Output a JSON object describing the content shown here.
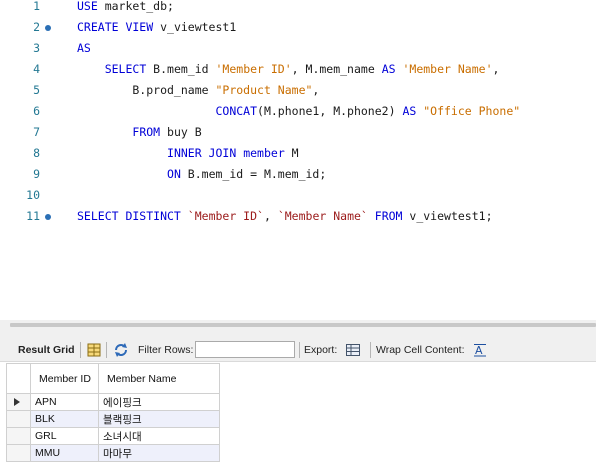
{
  "editor": {
    "lines": [
      {
        "n": "1",
        "fold": false,
        "tokens": [
          [
            "kw",
            "USE"
          ],
          [
            "tx",
            " market_db;"
          ]
        ]
      },
      {
        "n": "2",
        "fold": true,
        "tokens": [
          [
            "kw",
            "CREATE VIEW"
          ],
          [
            "tx",
            " v_viewtest1"
          ]
        ]
      },
      {
        "n": "3",
        "fold": false,
        "tokens": [
          [
            "kw",
            "AS"
          ]
        ]
      },
      {
        "n": "4",
        "fold": false,
        "tokens": [
          [
            "tx",
            "    "
          ],
          [
            "kw",
            "SELECT"
          ],
          [
            "tx",
            " B.mem_id "
          ],
          [
            "str",
            "'Member ID'"
          ],
          [
            "tx",
            ", M.mem_name "
          ],
          [
            "kw",
            "AS"
          ],
          [
            "tx",
            " "
          ],
          [
            "str",
            "'Member Name'"
          ],
          [
            "tx",
            ","
          ]
        ]
      },
      {
        "n": "5",
        "fold": false,
        "tokens": [
          [
            "tx",
            "        B.prod_name "
          ],
          [
            "str",
            "\"Product Name\""
          ],
          [
            "tx",
            ","
          ]
        ]
      },
      {
        "n": "6",
        "fold": false,
        "tokens": [
          [
            "tx",
            "                    "
          ],
          [
            "kw",
            "CONCAT"
          ],
          [
            "tx",
            "(M.phone1, M.phone2) "
          ],
          [
            "kw",
            "AS"
          ],
          [
            "tx",
            " "
          ],
          [
            "str",
            "\"Office Phone\""
          ]
        ]
      },
      {
        "n": "7",
        "fold": false,
        "tokens": [
          [
            "tx",
            "        "
          ],
          [
            "kw",
            "FROM"
          ],
          [
            "tx",
            " buy B"
          ]
        ]
      },
      {
        "n": "8",
        "fold": false,
        "tokens": [
          [
            "tx",
            "             "
          ],
          [
            "kw",
            "INNER JOIN"
          ],
          [
            "tx",
            " "
          ],
          [
            "kw",
            "member"
          ],
          [
            "tx",
            " M"
          ]
        ]
      },
      {
        "n": "9",
        "fold": false,
        "tokens": [
          [
            "tx",
            "             "
          ],
          [
            "kw",
            "ON"
          ],
          [
            "tx",
            " B.mem_id = M.mem_id;"
          ]
        ]
      },
      {
        "n": "10",
        "fold": false,
        "tokens": []
      },
      {
        "n": "11",
        "fold": true,
        "tokens": [
          [
            "kw",
            "SELECT DISTINCT"
          ],
          [
            "tx",
            " "
          ],
          [
            "id",
            "`Member ID`"
          ],
          [
            "tx",
            ", "
          ],
          [
            "id",
            "`Member Name`"
          ],
          [
            "tx",
            " "
          ],
          [
            "kw",
            "FROM"
          ],
          [
            "tx",
            " v_viewtest1;"
          ]
        ]
      }
    ]
  },
  "toolbar": {
    "result_grid": "Result Grid",
    "filter_rows": "Filter Rows:",
    "filter_value": "",
    "export": "Export:",
    "wrap_cell": "Wrap Cell Content:",
    "wrap_icon": "wrap-icon",
    "grid_icon": "grid-view-icon",
    "refresh_icon": "refresh-icon",
    "export_icon": "export-icon"
  },
  "grid": {
    "columns": [
      "Member ID",
      "Member Name"
    ],
    "rows": [
      [
        "APN",
        "에이핑크"
      ],
      [
        "BLK",
        "블랙핑크"
      ],
      [
        "GRL",
        "소녀시대"
      ],
      [
        "MMU",
        "마마무"
      ]
    ],
    "selected_row": 0
  },
  "colors": {
    "keyword": "#0000d7",
    "string": "#c96e00",
    "identifier": "#9b1b1b",
    "line_number": "#237893"
  }
}
